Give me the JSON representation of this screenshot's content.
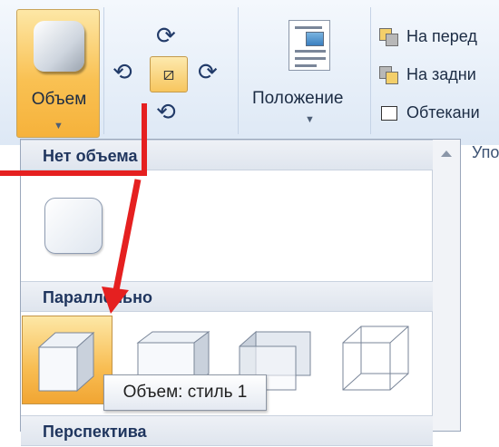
{
  "ribbon": {
    "volume_label": "Объем",
    "position_label": "Положение",
    "arrange_items": [
      {
        "label": "На перед",
        "icon": "bring-forward-icon"
      },
      {
        "label": "На задни",
        "icon": "send-backward-icon"
      },
      {
        "label": "Обтекани",
        "icon": "text-wrap-icon"
      }
    ],
    "group_label_partial": "Упо"
  },
  "gallery": {
    "sections": [
      {
        "label": "Нет объема"
      },
      {
        "label": "Параллельно"
      },
      {
        "label": "Перспектива"
      }
    ]
  },
  "tooltip": {
    "text": "Объем: стиль 1"
  },
  "colors": {
    "ribbon_bg": "#dde8f5",
    "selected_orange": "#f8bd52",
    "annotation_red": "#e52020",
    "section_text": "#1f355e"
  }
}
